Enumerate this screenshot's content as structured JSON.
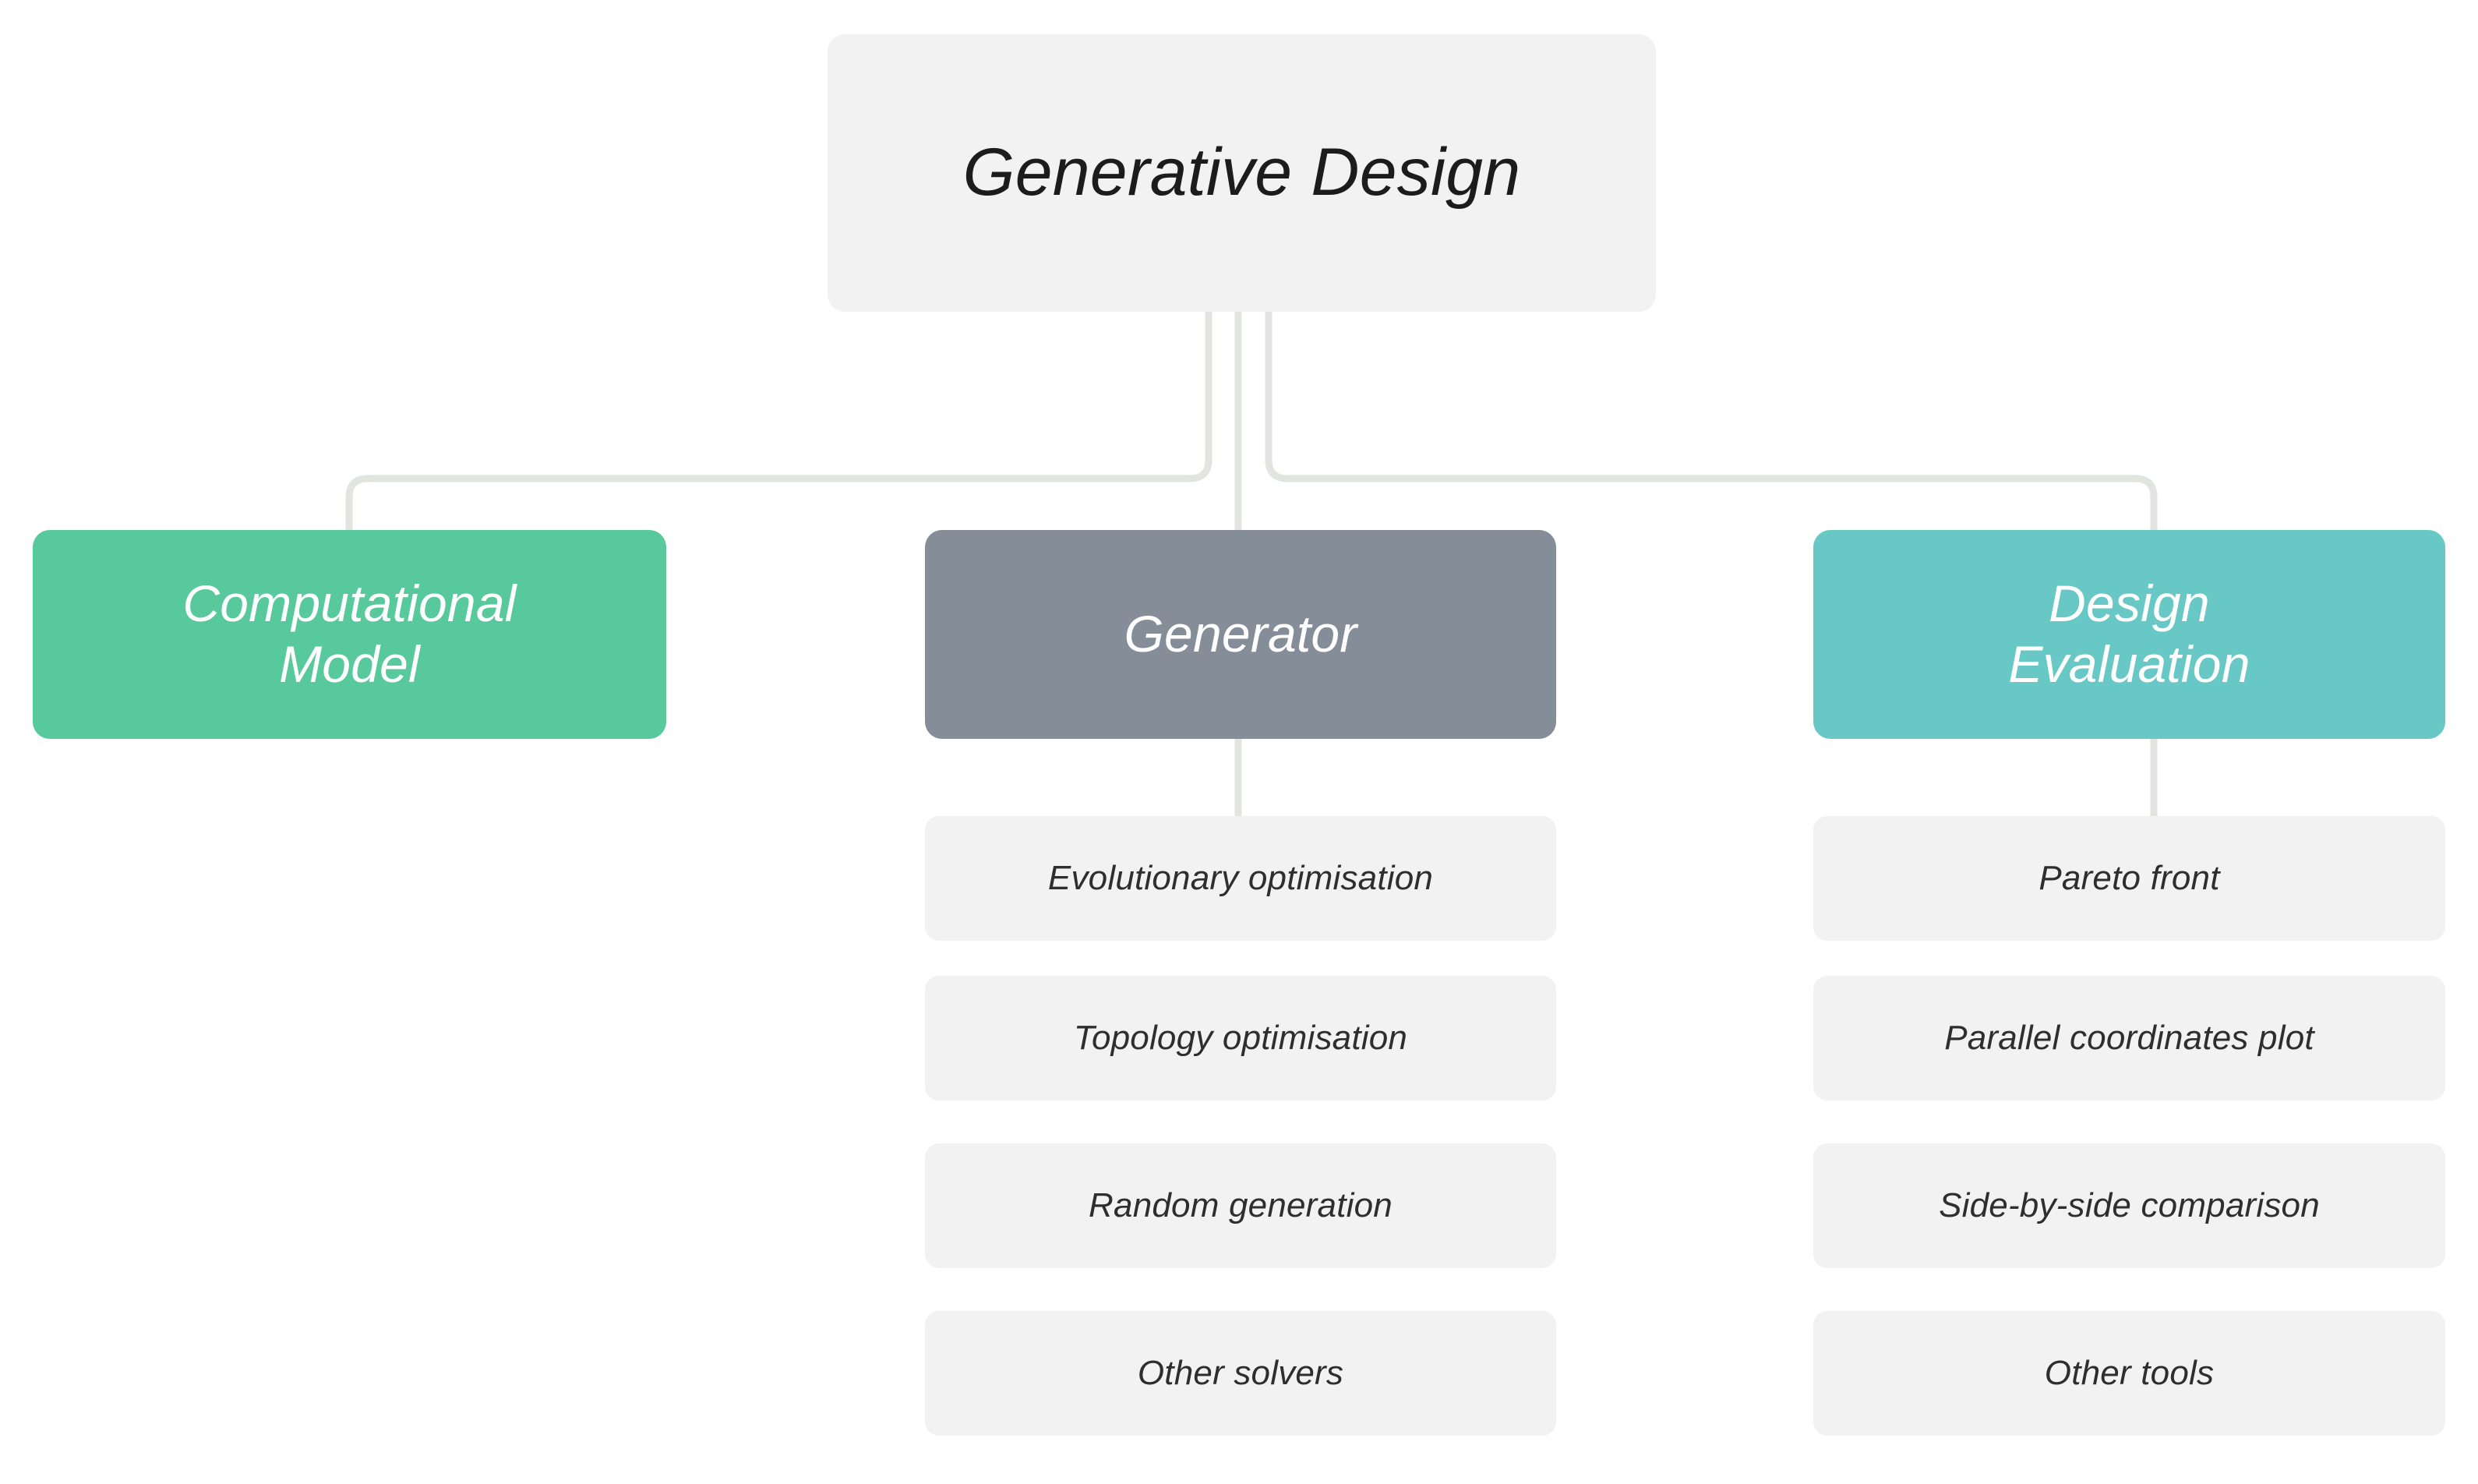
{
  "diagram": {
    "title": "Generative Design",
    "background_color": "#ffffff",
    "connector_color": "#e2e4e0",
    "root": {
      "label": "Generative Design",
      "fill": "#f2f2f2",
      "text_color": "#1c1c1c"
    },
    "branches": [
      {
        "id": "computational-model",
        "label": "Computational\nModel",
        "fill": "#57c99c",
        "text_color": "#ffffff",
        "children": []
      },
      {
        "id": "generator",
        "label": "Generator",
        "fill": "#848d98",
        "text_color": "#ffffff",
        "children": [
          {
            "label": "Evolutionary optimisation"
          },
          {
            "label": "Topology optimisation"
          },
          {
            "label": "Random generation"
          },
          {
            "label": "Other solvers"
          }
        ]
      },
      {
        "id": "design-evaluation",
        "label": "Design\nEvaluation",
        "fill": "#68c8c5",
        "text_color": "#ffffff",
        "children": [
          {
            "label": "Pareto front"
          },
          {
            "label": "Parallel coordinates plot"
          },
          {
            "label": "Side-by-side comparison"
          },
          {
            "label": "Other tools"
          }
        ]
      }
    ],
    "leaf_style": {
      "fill": "#f2f2f2",
      "text_color": "#2e2e2e"
    }
  }
}
